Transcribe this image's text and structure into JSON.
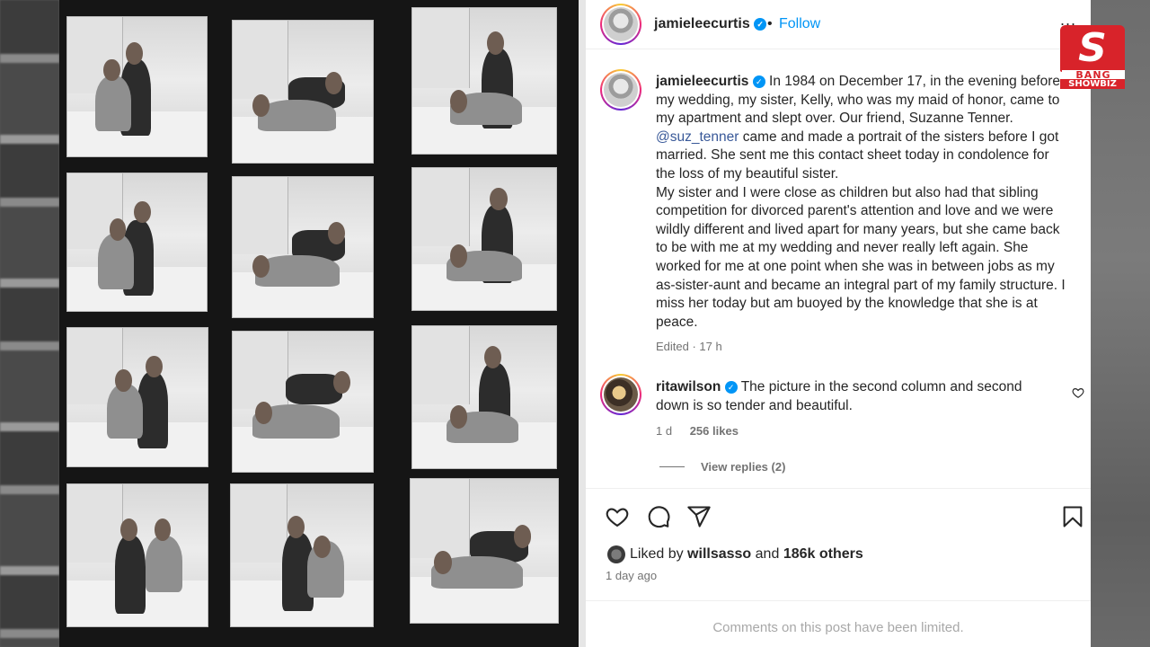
{
  "post": {
    "author": "jamieleecurtis",
    "follow_label": "Follow",
    "separator": "•",
    "more": "...",
    "caption_paragraph_1_before": "In 1984 on December 17, in the evening before my wedding, my sister, Kelly, who was my maid of honor, came to my apartment and slept over. Our friend, Suzanne Tenner.",
    "caption_mention": "@suz_tenner",
    "caption_paragraph_1_after": "came and made a portrait of the sisters before I got married. She sent me this contact sheet today in condolence for the loss of my beautiful sister.",
    "caption_paragraph_2": "My sister and I were close as children but also had that sibling competition for divorced parent's attention and love and we were wildly different and lived apart for many years, but she came back to be with me at my wedding and never really left again. She worked for me at one point when she was in between jobs as my as-sister-aunt and became an integral part of my family structure. I miss her today but am buoyed by the knowledge that she is at peace.",
    "edited_meta": "Edited · 17 h"
  },
  "comment": {
    "author": "ritawilson",
    "text": "The picture in the second column and second down is so tender and beautiful.",
    "age": "1 d",
    "likes": "256 likes",
    "view_replies": "View replies (2)"
  },
  "likes": {
    "prefix": "Liked by",
    "user": "willsasso",
    "joiner": "and",
    "others": "186k others",
    "time": "1 day ago"
  },
  "comments_limited": "Comments on this post have been limited.",
  "watermark": {
    "line1": "BANG",
    "line2": "SHOWBIZ",
    "letter": "S"
  },
  "colors": {
    "accent": "#0095f6",
    "mention": "#385898",
    "muted": "#737373",
    "watermark": "#d8232a"
  },
  "icons": [
    "heart-icon",
    "comment-icon",
    "share-icon",
    "bookmark-icon",
    "verified-icon",
    "more-icon"
  ]
}
